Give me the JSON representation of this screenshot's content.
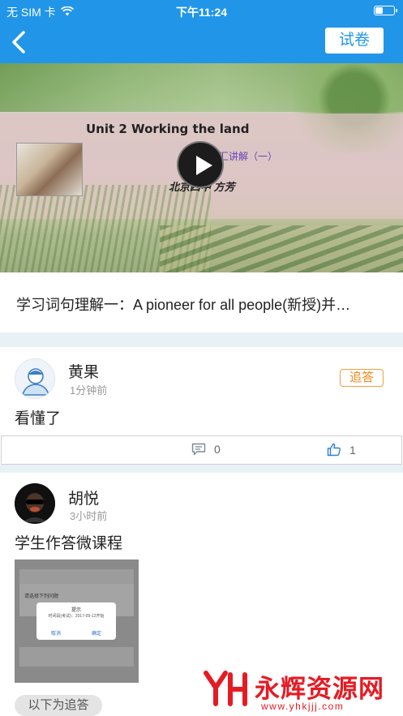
{
  "status_bar": {
    "carrier": "无 SIM 卡",
    "time": "下午11:24"
  },
  "nav": {
    "exam_button": "试卷"
  },
  "video": {
    "slide_title": "Unit 2 Working the land",
    "slide_subtitle": "词汇讲解（一）",
    "slide_author": "北京四中 方芳"
  },
  "lesson": {
    "title": "学习词句理解一：A pioneer for all people(新授)并…"
  },
  "comments": [
    {
      "name": "黄果",
      "time": "1分钟前",
      "text": "看懂了",
      "reply_label": "追答",
      "comment_count": "0",
      "like_count": "1"
    },
    {
      "name": "胡悦",
      "time": "3小时前",
      "text": "学生作答微课程",
      "follow_label": "以下为追答",
      "thumbnail": {
        "dialog_title": "提示",
        "dialog_message": "时间段(考试)：2017-09-12开始",
        "cancel": "取消",
        "confirm": "确定",
        "row_text": "请选择下列问题"
      }
    }
  ],
  "watermark": {
    "brand": "永辉资源网",
    "url": "www.yhkjjj.com",
    "color": "#e51b24"
  },
  "colors": {
    "primary": "#2196e8",
    "accent_orange": "#f08a20"
  }
}
